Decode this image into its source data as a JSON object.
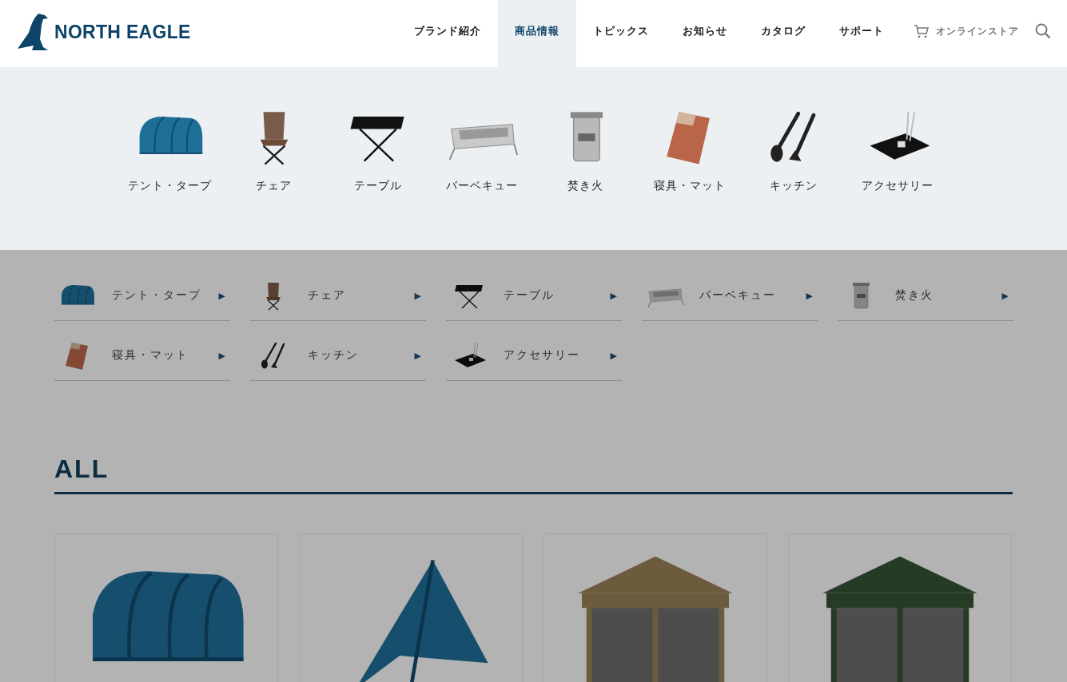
{
  "header": {
    "logo_text": "NORTH EAGLE",
    "nav": [
      {
        "label": "ブランド紹介",
        "selected": false
      },
      {
        "label": "商品情報",
        "selected": true
      },
      {
        "label": "トピックス",
        "selected": false
      },
      {
        "label": "お知らせ",
        "selected": false
      },
      {
        "label": "カタログ",
        "selected": false
      },
      {
        "label": "サポート",
        "selected": false
      }
    ],
    "store_link": "オンラインストア"
  },
  "mega_menu": {
    "items": [
      {
        "kind": "tent",
        "label": "テント・タープ"
      },
      {
        "kind": "chair",
        "label": "チェア"
      },
      {
        "kind": "table",
        "label": "テーブル"
      },
      {
        "kind": "grill",
        "label": "バーベキュー"
      },
      {
        "kind": "stove",
        "label": "焚き火"
      },
      {
        "kind": "sleepingbag",
        "label": "寝具・マット"
      },
      {
        "kind": "utensils",
        "label": "キッチン"
      },
      {
        "kind": "tray",
        "label": "アクセサリー"
      }
    ]
  },
  "categories": [
    {
      "kind": "tent",
      "label": "テント・タープ",
      "arrow": "▶"
    },
    {
      "kind": "chair",
      "label": "チェア",
      "arrow": "▶"
    },
    {
      "kind": "table",
      "label": "テーブル",
      "arrow": "▶"
    },
    {
      "kind": "grill",
      "label": "バーベキュー",
      "arrow": "▶"
    },
    {
      "kind": "stove",
      "label": "焚き火",
      "arrow": "▶"
    },
    {
      "kind": "sleepingbag",
      "label": "寝具・マット",
      "arrow": "▶"
    },
    {
      "kind": "utensils",
      "label": "キッチン",
      "arrow": "▶"
    },
    {
      "kind": "tray",
      "label": "アクセサリー",
      "arrow": "▶"
    }
  ],
  "section_title": "ALL",
  "products": [
    {
      "kind": "tent"
    },
    {
      "kind": "tarp"
    },
    {
      "kind": "gazebo",
      "color": "#6b5c3e"
    },
    {
      "kind": "gazebo",
      "color": "#253b25"
    }
  ]
}
